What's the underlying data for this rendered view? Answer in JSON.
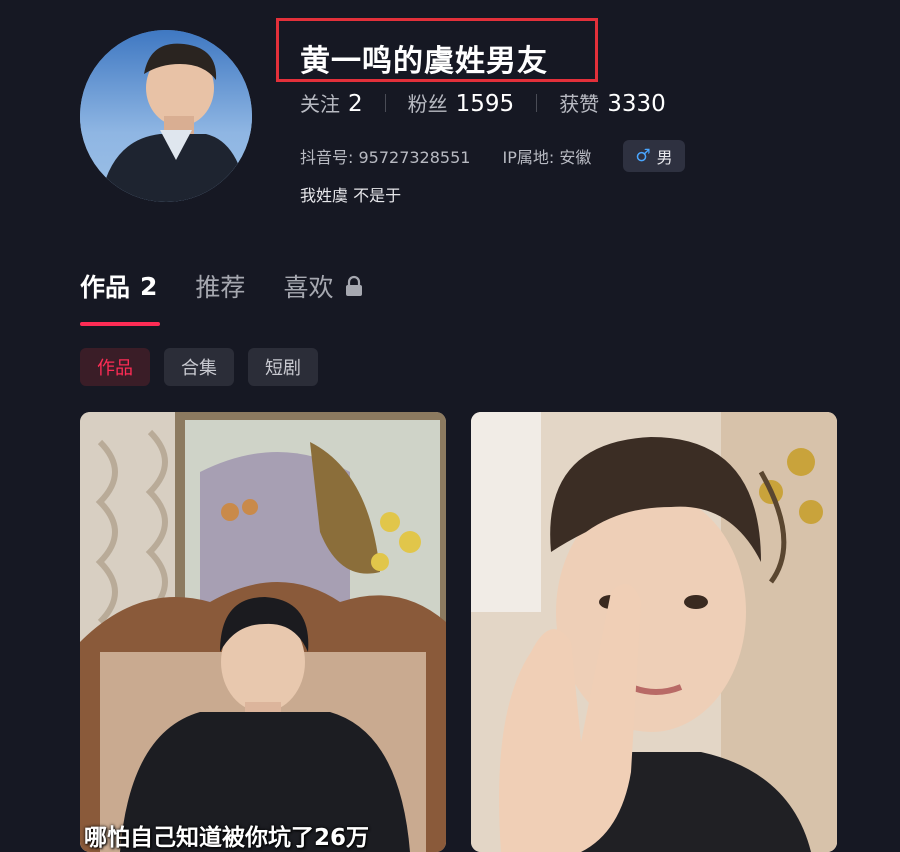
{
  "profile": {
    "name": "黄一鸣的虞姓男友",
    "stats": [
      {
        "label": "关注",
        "value": "2"
      },
      {
        "label": "粉丝",
        "value": "1595"
      },
      {
        "label": "获赞",
        "value": "3330"
      }
    ],
    "account_id": "抖音号: 95727328551",
    "ip_location": "IP属地: 安徽",
    "gender_symbol": "♂",
    "gender": "男",
    "bio": "我姓虞 不是于"
  },
  "tabs": [
    {
      "label": "作品",
      "count": "2"
    },
    {
      "label": "推荐"
    },
    {
      "label": "喜欢"
    }
  ],
  "chips": [
    "作品",
    "合集",
    "短剧"
  ],
  "videos": [
    {
      "caption": "哪怕自己知道被你坑了26万"
    },
    {
      "caption": ""
    }
  ],
  "colors": {
    "background": "#161823",
    "accent": "#fe2c55",
    "highlight_box": "#e3303a"
  }
}
